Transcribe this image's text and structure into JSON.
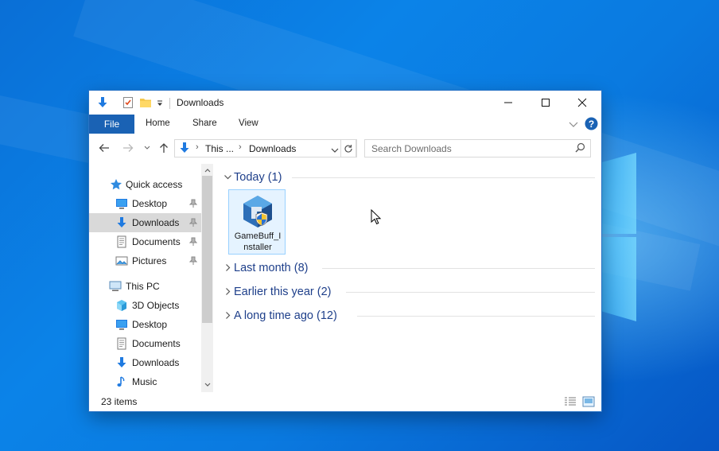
{
  "window": {
    "title": "Downloads",
    "quick_access_icons": [
      "download-arrow-icon",
      "properties-check-icon",
      "new-folder-icon",
      "customize-dropdown-icon"
    ]
  },
  "ribbon": {
    "tabs": [
      {
        "label": "File",
        "active": true
      },
      {
        "label": "Home"
      },
      {
        "label": "Share"
      },
      {
        "label": "View"
      }
    ]
  },
  "address": {
    "segments": [
      "This ...",
      "Downloads"
    ],
    "search_placeholder": "Search Downloads"
  },
  "nav": {
    "quick_access": {
      "label": "Quick access",
      "items": [
        {
          "label": "Desktop",
          "icon": "desktop-icon",
          "pinned": true
        },
        {
          "label": "Downloads",
          "icon": "downloads-icon",
          "pinned": true,
          "selected": true
        },
        {
          "label": "Documents",
          "icon": "documents-icon",
          "pinned": true
        },
        {
          "label": "Pictures",
          "icon": "pictures-icon",
          "pinned": true
        }
      ]
    },
    "this_pc": {
      "label": "This PC",
      "items": [
        {
          "label": "3D Objects",
          "icon": "3d-objects-icon"
        },
        {
          "label": "Desktop",
          "icon": "desktop-icon"
        },
        {
          "label": "Documents",
          "icon": "documents-icon"
        },
        {
          "label": "Downloads",
          "icon": "downloads-icon"
        },
        {
          "label": "Music",
          "icon": "music-icon"
        }
      ]
    }
  },
  "content": {
    "groups": [
      {
        "label": "Today (1)",
        "expanded": true
      },
      {
        "label": "Last month (8)",
        "expanded": false
      },
      {
        "label": "Earlier this year (2)",
        "expanded": false
      },
      {
        "label": "A long time ago (12)",
        "expanded": false
      }
    ],
    "files": [
      {
        "name_line1": "GameBuff_I",
        "name_line2": "nstaller",
        "icon": "installer-shield-icon"
      }
    ]
  },
  "status": {
    "item_count": "23 items"
  },
  "colors": {
    "accent": "#1a62b4",
    "selection_bg": "#e5f3ff",
    "selection_border": "#99d1ff",
    "group_header": "#1e3f8a",
    "desktop_blue": "#0a78de"
  }
}
